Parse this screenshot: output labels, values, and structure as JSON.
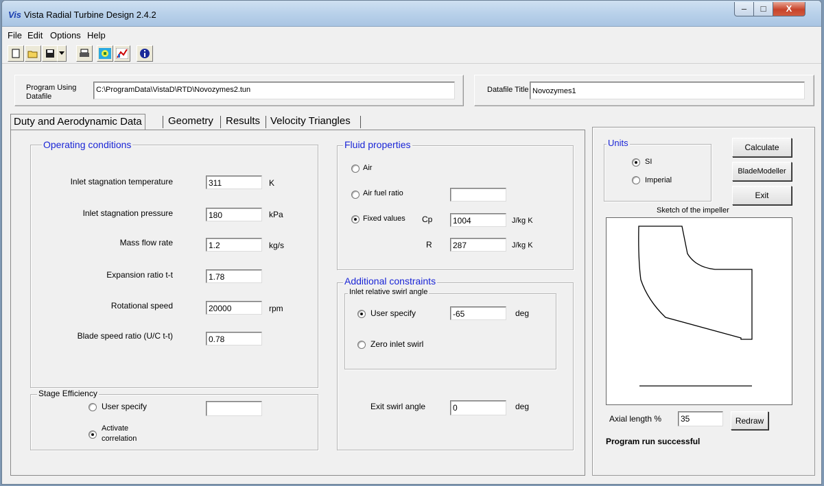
{
  "window": {
    "logo": "Vis",
    "title": "Vista Radial Turbine Design 2.4.2",
    "controls": {
      "minimize": "–",
      "maximize": "□",
      "close": "X"
    }
  },
  "menu": {
    "file": "File",
    "edit": "Edit",
    "options": "Options",
    "help": "Help"
  },
  "toolbar": {
    "icons": [
      "new-file-icon",
      "open-folder-icon",
      "save-disk-icon",
      "dropdown-arrow-icon",
      "print-icon",
      "calculate-icon",
      "chart-icon",
      "info-icon"
    ]
  },
  "header": {
    "program_label_line1": "Program Using",
    "program_label_line2": "Datafile",
    "program_path": "C:\\ProgramData\\VistaD\\RTD\\Novozymes2.tun",
    "datafile_title_label": "Datafile Title",
    "datafile_title": "Novozymes1"
  },
  "tabs": [
    "Duty and Aerodynamic Data",
    "Geometry",
    "Results",
    "Velocity Triangles"
  ],
  "operating": {
    "title": "Operating conditions",
    "rows": [
      {
        "label": "Inlet stagnation temperature",
        "value": "311",
        "unit": "K"
      },
      {
        "label": "Inlet stagnation pressure",
        "value": "180",
        "unit": "kPa"
      },
      {
        "label": "Mass flow rate",
        "value": "1.2",
        "unit": "kg/s"
      },
      {
        "label": "Expansion ratio t-t",
        "value": "1.78",
        "unit": ""
      },
      {
        "label": "Rotational speed",
        "value": "20000",
        "unit": "rpm"
      },
      {
        "label": "Blade speed ratio (U/C t-t)",
        "value": "0.78",
        "unit": ""
      }
    ]
  },
  "stage_efficiency": {
    "title": "Stage Efficiency",
    "user_specify": "User specify",
    "user_value": "",
    "activate_line1": "Activate",
    "activate_line2": "correlation",
    "selected": "activate"
  },
  "fluid": {
    "title": "Fluid properties",
    "air": "Air",
    "air_fuel_ratio": "Air fuel ratio",
    "air_fuel_value": "",
    "fixed_values": "Fixed values",
    "selected": "fixed",
    "cp_label": "Cp",
    "cp_value": "1004",
    "cp_unit": "J/kg K",
    "r_label": "R",
    "r_value": "287",
    "r_unit": "J/kg K"
  },
  "constraints": {
    "title": "Additional constraints",
    "subgroup": "Inlet relative swirl angle",
    "user_specify": "User specify",
    "swirl_value": "-65",
    "swirl_unit": "deg",
    "zero_swirl": "Zero inlet swirl",
    "selected": "user",
    "exit_label": "Exit swirl angle",
    "exit_value": "0",
    "exit_unit": "deg"
  },
  "units": {
    "title": "Units",
    "si": "SI",
    "imperial": "Imperial",
    "selected": "SI"
  },
  "buttons": {
    "calculate": "Calculate",
    "blademodeller": "BladeModeller",
    "exit": "Exit",
    "redraw": "Redraw"
  },
  "sketch": {
    "title": "Sketch of the impeller",
    "axial_label": "Axial length %",
    "axial_value": "35"
  },
  "status": "Program run successful"
}
